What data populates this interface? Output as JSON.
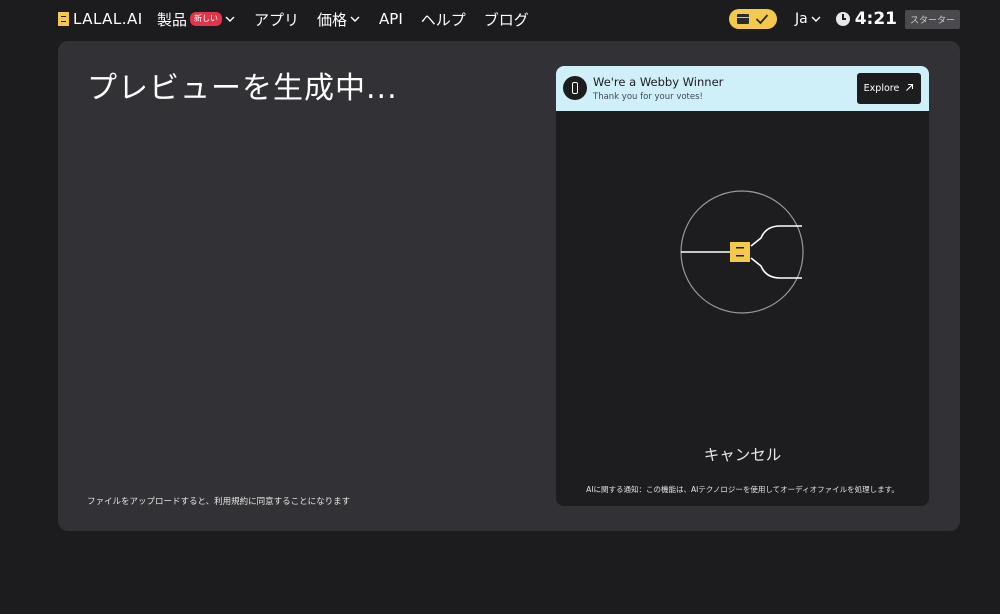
{
  "brand": {
    "name": "LALAL.AI"
  },
  "nav": {
    "products": "製品",
    "new_badge": "新しい",
    "apps": "アプリ",
    "pricing": "価格",
    "api": "API",
    "help": "ヘルプ",
    "blog": "ブログ"
  },
  "header_right": {
    "language": "Ja",
    "time": "4:21",
    "plan": "スターター"
  },
  "main": {
    "title": "プレビューを生成中...",
    "footer_note": "ファイルをアップロードすると、利用規約に同意することになります"
  },
  "card": {
    "banner_title": "We're a Webby Winner",
    "banner_subtitle": "Thank you for your votes!",
    "explore_label": "Explore",
    "cancel_label": "キャンセル",
    "ai_notice": "AIに関する通知：この機能は、AIテクノロジーを使用してオーディオファイルを処理します。"
  },
  "colors": {
    "background": "#1c1b1e",
    "panel": "#323135",
    "card": "#1d1c1f",
    "accent_yellow": "#f2c94c",
    "banner": "#cfeff9",
    "badge_red": "#e0364b"
  }
}
